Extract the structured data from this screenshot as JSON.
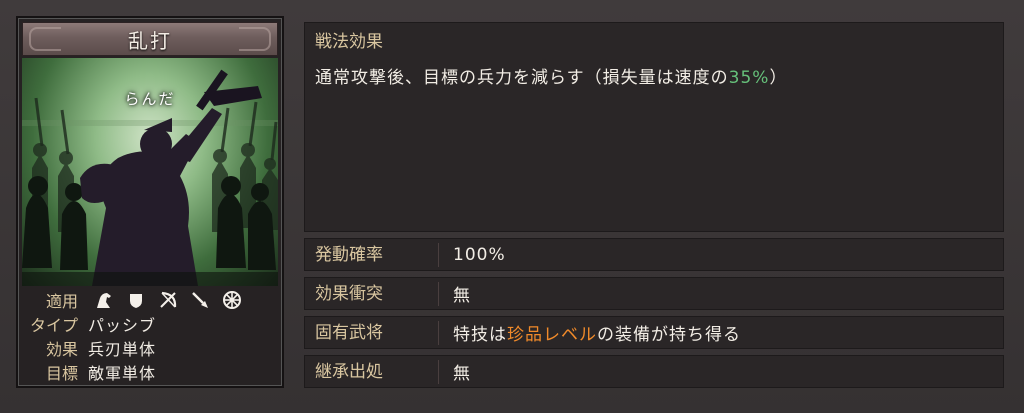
{
  "card": {
    "title": "乱打",
    "reading": "らんだ",
    "apply_label": "適用",
    "apply_icons": [
      "cavalry-icon",
      "shield-icon",
      "bow-icon",
      "spear-icon",
      "wheel-icon"
    ],
    "type_label": "タイプ",
    "type_value": "パッシブ",
    "effect_label": "効果",
    "effect_value": "兵刃単体",
    "target_label": "目標",
    "target_value": "敵軍単体"
  },
  "effect": {
    "title": "戦法効果",
    "text_before": "通常攻撃後、目標の兵力を減らす（損失量は速度の",
    "text_highlight": "35%",
    "text_after": "）"
  },
  "rows": {
    "rate_label": "発動確率",
    "rate_value": "100%",
    "conflict_label": "効果衝突",
    "conflict_value": "無",
    "unique_label": "固有武将",
    "unique_before": "特技は",
    "unique_highlight": "珍品レベル",
    "unique_after": "の装備が持ち得る",
    "inherit_label": "継承出処",
    "inherit_value": "無"
  },
  "colors": {
    "label": "#d9c6a0",
    "highlight_green": "#66c07a",
    "highlight_orange": "#f08a2a"
  }
}
